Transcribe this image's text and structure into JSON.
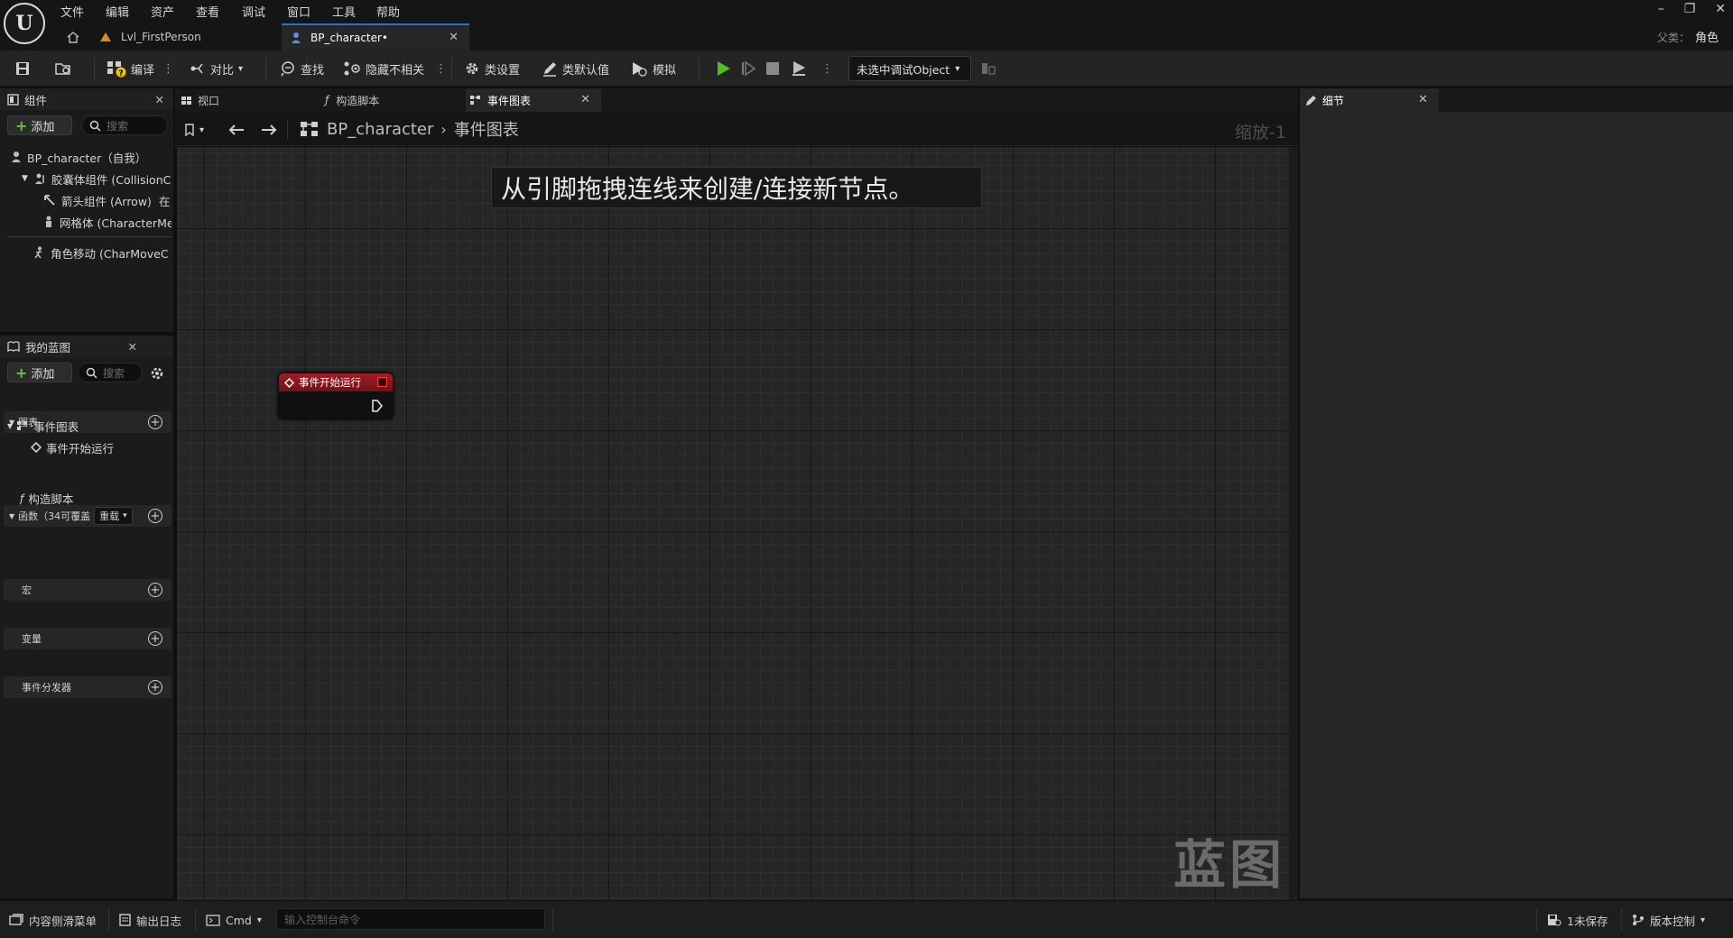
{
  "menu": [
    "文件",
    "编辑",
    "资产",
    "查看",
    "调试",
    "窗口",
    "工具",
    "帮助"
  ],
  "tabs": {
    "level": "Lvl_FirstPerson",
    "blueprint": "BP_character•"
  },
  "parent_class": {
    "label": "父类：",
    "value": "角色"
  },
  "toolbar": {
    "compile": "编译",
    "diff": "对比",
    "find": "查找",
    "hide_unrelated": "隐藏不相关",
    "class_settings": "类设置",
    "class_defaults": "类默认值",
    "simulate": "模拟",
    "debug_object": "未选中调试Object"
  },
  "components_panel": {
    "title": "组件",
    "add": "添加",
    "search_placeholder": "搜索",
    "items": [
      "BP_character（自我）",
      "胶囊体组件 (CollisionC",
      "箭头组件 (Arrow)",
      "网格体 (CharacterMe",
      "角色移动 (CharMoveC"
    ],
    "arrow_suffix": "在"
  },
  "my_blueprint": {
    "title": "我的蓝图",
    "add": "添加",
    "search_placeholder": "搜索",
    "graphs_label": "图表",
    "event_graph": "事件图表",
    "begin_play": "事件开始运行",
    "functions_label": "函数（34可覆盖",
    "override_label": "重载",
    "construction_script": "构造脚本",
    "macros_label": "宏",
    "variables_label": "变量",
    "dispatchers_label": "事件分发器"
  },
  "editor_tabs": {
    "viewport": "视口",
    "construction": "构造脚本",
    "event_graph": "事件图表"
  },
  "breadcrumb": {
    "blueprint": "BP_character",
    "graph": "事件图表"
  },
  "graph": {
    "hint": "从引脚拖拽连线来创建/连接新节点。",
    "zoom": "缩放-1",
    "watermark": "蓝图",
    "node_title": "事件开始运行"
  },
  "details": {
    "title": "细节"
  },
  "statusbar": {
    "content_drawer": "内容侧滑菜单",
    "output_log": "输出日志",
    "cmd": "Cmd",
    "console_placeholder": "输入控制台命令",
    "unsaved": "1未保存",
    "source_control": "版本控制"
  },
  "colors": {
    "accent": "#2a6fd6",
    "event_node": "#a21d24",
    "add_green": "#5fc33b",
    "play_green": "#4fbf26"
  }
}
